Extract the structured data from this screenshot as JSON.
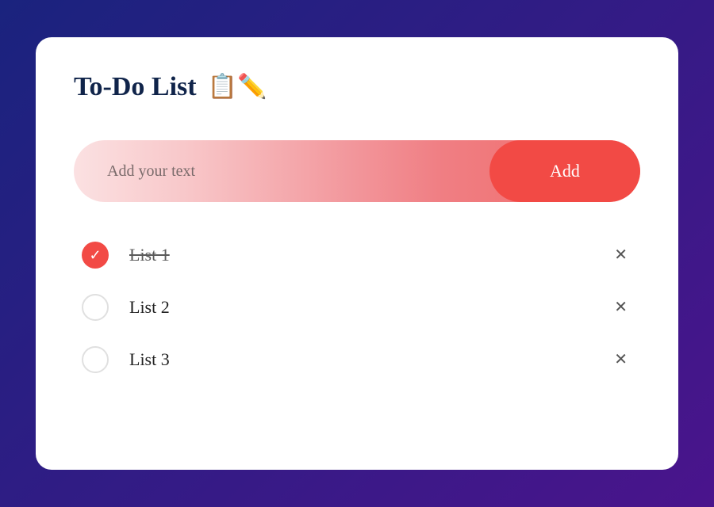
{
  "header": {
    "title": "To-Do List",
    "icon": "📋✏️"
  },
  "input": {
    "placeholder": "Add your text",
    "value": ""
  },
  "add_button_label": "Add",
  "items": [
    {
      "label": "List 1",
      "checked": true
    },
    {
      "label": "List 2",
      "checked": false
    },
    {
      "label": "List 3",
      "checked": false
    }
  ],
  "icons": {
    "check": "✓",
    "close": "✕"
  },
  "colors": {
    "accent": "#f24a45",
    "heading": "#10244a"
  }
}
